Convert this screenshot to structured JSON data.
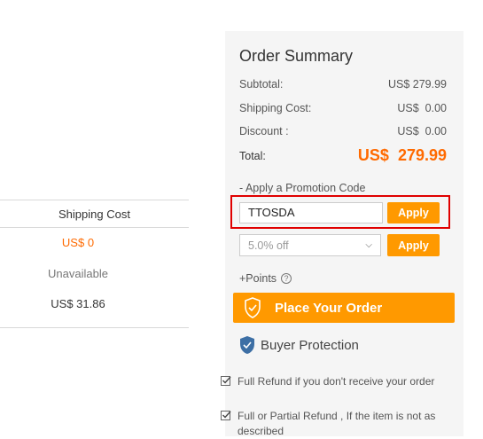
{
  "shipping_table": {
    "header": "Shipping Cost",
    "rows": [
      "US$ 0",
      "Unavailable",
      "US$ 31.86"
    ]
  },
  "order_summary": {
    "title": "Order Summary",
    "subtotal_label": "Subtotal:",
    "subtotal_value": "US$ 279.99",
    "shipping_label": "Shipping Cost:",
    "shipping_value": "US$  0.00",
    "discount_label": "Discount :",
    "discount_value": "US$  0.00",
    "total_label": "Total:",
    "total_currency": "US$",
    "total_amount": "279.99",
    "promo_label": "- Apply a Promotion Code",
    "promo_code_value": "TTOSDA",
    "apply_label": "Apply",
    "coupon_selected": "5.0% off",
    "apply_coupon_label": "Apply",
    "points_label": "+Points",
    "place_order_label": "Place Your Order",
    "buyer_protection_label": "Buyer Protection",
    "guarantees": [
      "Full Refund if you don't receive your order",
      "Full or Partial Refund , If the item is not as described"
    ]
  },
  "colors": {
    "accent": "#ff9900",
    "price": "#ff6a00",
    "highlight_box": "#e00000",
    "shield_blue": "#3d6fa5"
  },
  "icons": [
    "shield-check-icon",
    "buyer-protection-shield-icon",
    "question-icon",
    "chevron-down-icon",
    "checkbox-icon"
  ]
}
